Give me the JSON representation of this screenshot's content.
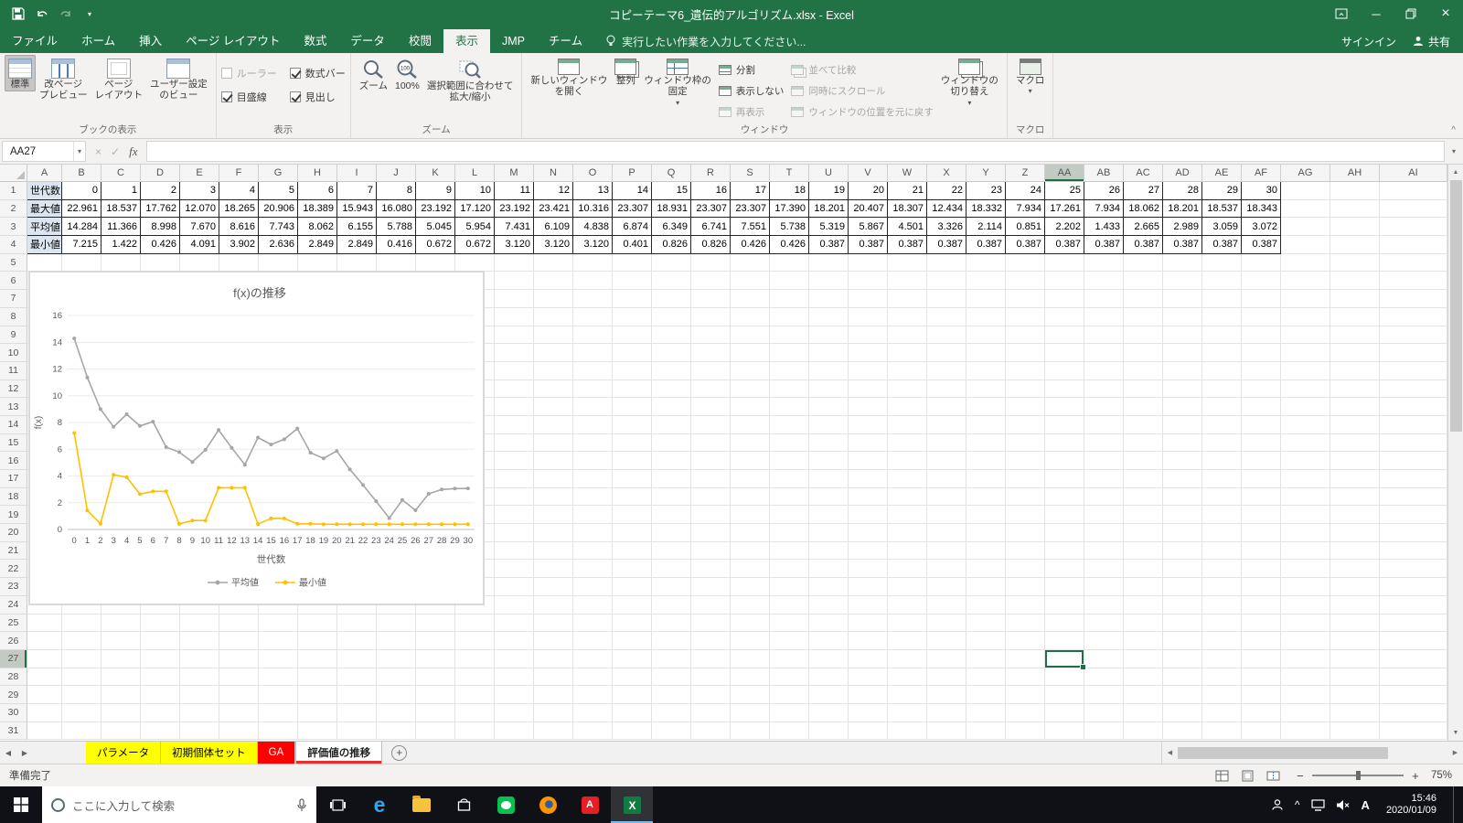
{
  "window": {
    "title": "コピーテーマ6_遺伝的アルゴリズム.xlsx - Excel"
  },
  "account": {
    "sign_in": "サインイン",
    "share": "共有"
  },
  "tell_me": "実行したい作業を入力してください...",
  "ribbon_tabs": [
    {
      "label": "ファイル",
      "active": false
    },
    {
      "label": "ホーム",
      "active": false
    },
    {
      "label": "挿入",
      "active": false
    },
    {
      "label": "ページ レイアウト",
      "active": false
    },
    {
      "label": "数式",
      "active": false
    },
    {
      "label": "データ",
      "active": false
    },
    {
      "label": "校閲",
      "active": false
    },
    {
      "label": "表示",
      "active": true
    },
    {
      "label": "JMP",
      "active": false
    },
    {
      "label": "チーム",
      "active": false
    }
  ],
  "ribbon": {
    "book_views": {
      "label": "ブックの表示",
      "items": [
        "標準",
        "改ページ\nプレビュー",
        "ページ\nレイアウト",
        "ユーザー設定\nのビュー"
      ],
      "selected": "標準"
    },
    "show": {
      "label": "表示",
      "checkboxes": [
        {
          "label": "ルーラー",
          "checked": false,
          "enabled": false
        },
        {
          "label": "数式バー",
          "checked": true,
          "enabled": true
        },
        {
          "label": "目盛線",
          "checked": true,
          "enabled": true
        },
        {
          "label": "見出し",
          "checked": true,
          "enabled": true
        }
      ]
    },
    "zoom": {
      "label": "ズーム",
      "items": [
        "ズーム",
        "100%",
        "選択範囲に合わせて\n拡大/縮小"
      ]
    },
    "window": {
      "label": "ウィンドウ",
      "large": [
        "新しいウィンドウ\nを開く",
        "整列",
        "ウィンドウ枠の\n固定"
      ],
      "small": [
        "分割",
        "表示しない",
        "再表示"
      ],
      "disabled": [
        "並べて比較",
        "同時にスクロール",
        "ウィンドウの位置を元に戻す"
      ],
      "switch": "ウィンドウの\n切り替え"
    },
    "macro": {
      "label": "マクロ",
      "item": "マクロ"
    }
  },
  "formula_bar": {
    "name_box": "AA27",
    "formula": ""
  },
  "grid": {
    "columns": [
      "A",
      "B",
      "C",
      "D",
      "E",
      "F",
      "G",
      "H",
      "I",
      "J",
      "K",
      "L",
      "M",
      "N",
      "O",
      "P",
      "Q",
      "R",
      "S",
      "T",
      "U",
      "V",
      "W",
      "X",
      "Y",
      "Z",
      "AA",
      "AB",
      "AC",
      "AD",
      "AE",
      "AF",
      "AG",
      "AH",
      "AI"
    ],
    "row_count": 31,
    "selected_column": "AA",
    "selected_row": 27,
    "label_fill": "#dce6f1",
    "rows_data": [
      {
        "label": "世代数",
        "format": "int",
        "values": [
          0,
          1,
          2,
          3,
          4,
          5,
          6,
          7,
          8,
          9,
          10,
          11,
          12,
          13,
          14,
          15,
          16,
          17,
          18,
          19,
          20,
          21,
          22,
          23,
          24,
          25,
          26,
          27,
          28,
          29,
          30
        ]
      },
      {
        "label": "最大値",
        "format": "3dp",
        "values": [
          22.961,
          18.537,
          17.762,
          12.07,
          18.265,
          20.906,
          18.389,
          15.943,
          16.08,
          23.192,
          17.12,
          23.192,
          23.421,
          10.316,
          23.307,
          18.931,
          23.307,
          23.307,
          17.39,
          18.201,
          20.407,
          18.307,
          12.434,
          18.332,
          7.934,
          17.261,
          7.934,
          18.062,
          18.201,
          18.537,
          18.343
        ]
      },
      {
        "label": "平均値",
        "format": "3dp",
        "values": [
          14.284,
          11.366,
          8.998,
          7.67,
          8.616,
          7.743,
          8.062,
          6.155,
          5.788,
          5.045,
          5.954,
          7.431,
          6.109,
          4.838,
          6.874,
          6.349,
          6.741,
          7.551,
          5.738,
          5.319,
          5.867,
          4.501,
          3.326,
          2.114,
          0.851,
          2.202,
          1.433,
          2.665,
          2.989,
          3.059,
          3.072
        ]
      },
      {
        "label": "最小値",
        "format": "3dp",
        "values": [
          7.215,
          1.422,
          0.426,
          4.091,
          3.902,
          2.636,
          2.849,
          2.849,
          0.416,
          0.672,
          0.672,
          3.12,
          3.12,
          3.12,
          0.401,
          0.826,
          0.826,
          0.426,
          0.426,
          0.387,
          0.387,
          0.387,
          0.387,
          0.387,
          0.387,
          0.387,
          0.387,
          0.387,
          0.387,
          0.387,
          0.387
        ]
      }
    ]
  },
  "chart_data": {
    "type": "line",
    "title": "f(x)の推移",
    "xlabel": "世代数",
    "ylabel": "f(x)",
    "x": [
      0,
      1,
      2,
      3,
      4,
      5,
      6,
      7,
      8,
      9,
      10,
      11,
      12,
      13,
      14,
      15,
      16,
      17,
      18,
      19,
      20,
      21,
      22,
      23,
      24,
      25,
      26,
      27,
      28,
      29,
      30
    ],
    "ylim": [
      0,
      16
    ],
    "ytick_step": 2,
    "grid": true,
    "legend_position": "bottom",
    "series": [
      {
        "name": "平均値",
        "color": "#a6a6a6",
        "values": [
          14.284,
          11.366,
          8.998,
          7.67,
          8.616,
          7.743,
          8.062,
          6.155,
          5.788,
          5.045,
          5.954,
          7.431,
          6.109,
          4.838,
          6.874,
          6.349,
          6.741,
          7.551,
          5.738,
          5.319,
          5.867,
          4.501,
          3.326,
          2.114,
          0.851,
          2.202,
          1.433,
          2.665,
          2.989,
          3.059,
          3.072
        ]
      },
      {
        "name": "最小値",
        "color": "#ffc000",
        "values": [
          7.215,
          1.422,
          0.426,
          4.091,
          3.902,
          2.636,
          2.849,
          2.849,
          0.416,
          0.672,
          0.672,
          3.12,
          3.12,
          3.12,
          0.401,
          0.826,
          0.826,
          0.426,
          0.426,
          0.387,
          0.387,
          0.387,
          0.387,
          0.387,
          0.387,
          0.387,
          0.387,
          0.387,
          0.387,
          0.387,
          0.387
        ]
      }
    ]
  },
  "sheet_tabs": [
    {
      "label": "パラメータ",
      "color": "#ffff00",
      "text": "#000000",
      "active": false
    },
    {
      "label": "初期個体セット",
      "color": "#ffff00",
      "text": "#000000",
      "active": false
    },
    {
      "label": "GA",
      "color": "#ff0000",
      "text": "#ffffff",
      "active": false
    },
    {
      "label": "評価値の推移",
      "active": true,
      "underline": "#e03030"
    }
  ],
  "status_bar": {
    "mode": "準備完了",
    "zoom": "75%"
  },
  "taskbar": {
    "search_placeholder": "ここに入力して検索",
    "time": "15:46",
    "date": "2020/01/09",
    "ime": "A"
  },
  "colors": {
    "titlebar": "#217346",
    "selection": "#1e7145",
    "series_avg": "#a6a6a6",
    "series_min": "#ffc000",
    "label_fill": "#dce6f1"
  }
}
